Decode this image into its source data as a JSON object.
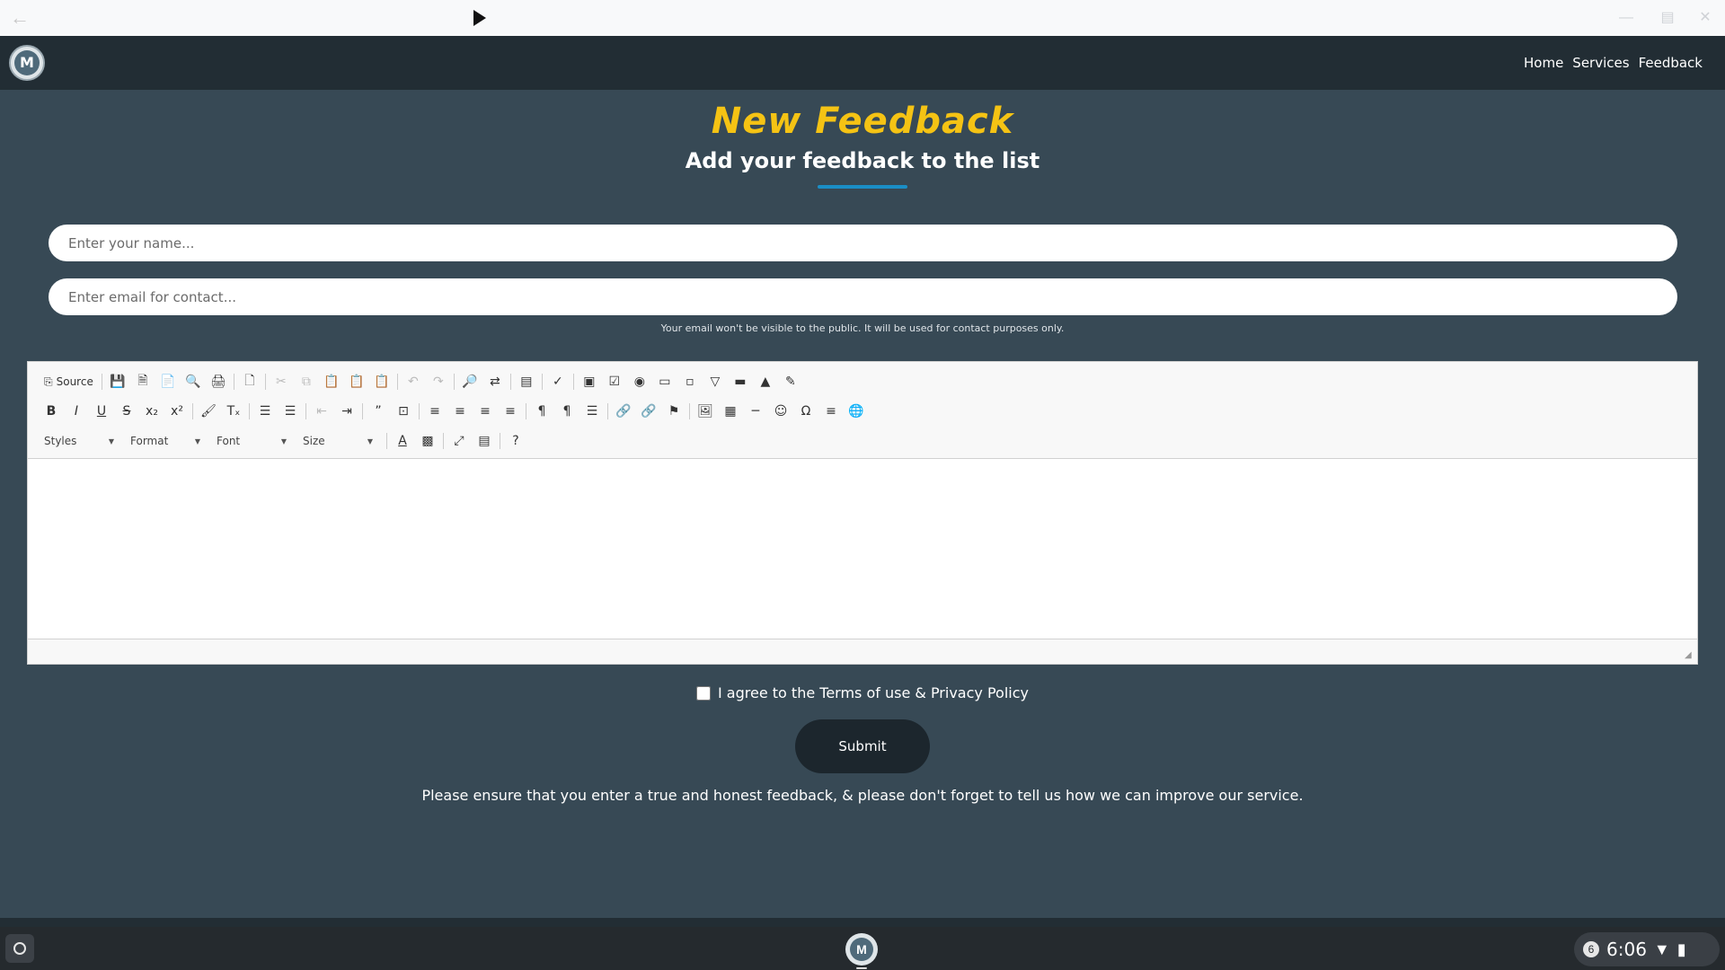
{
  "window": {
    "back_icon": "arrow-left-icon",
    "controls": [
      "minimize-icon",
      "maximize-icon",
      "close-icon"
    ]
  },
  "header": {
    "logo_letter": "M",
    "nav": [
      {
        "label": "Home"
      },
      {
        "label": "Services"
      },
      {
        "label": "Feedback"
      }
    ]
  },
  "page": {
    "title": "New Feedback",
    "subtitle": "Add your feedback to the list"
  },
  "form": {
    "name_placeholder": "Enter your name...",
    "email_placeholder": "Enter email for contact...",
    "email_hint": "Your email won't be visible to the public. It will be used for contact purposes only.",
    "agree_label": "I agree to the Terms of use & Privacy Policy",
    "submit_label": "Submit",
    "note": "Please ensure that you enter a true and honest feedback, & please don't forget to tell us how we can improve our service."
  },
  "editor": {
    "source_label": "Source",
    "combos": {
      "styles": "Styles",
      "format": "Format",
      "font": "Font",
      "size": "Size"
    }
  },
  "shelf": {
    "app_letter": "M",
    "notification_count": "6",
    "time": "6:06"
  },
  "colors": {
    "title": "#f5c314",
    "background": "#374955",
    "header": "#222d34",
    "accent_rule": "#1a8ec6",
    "submit": "#1c262d"
  }
}
